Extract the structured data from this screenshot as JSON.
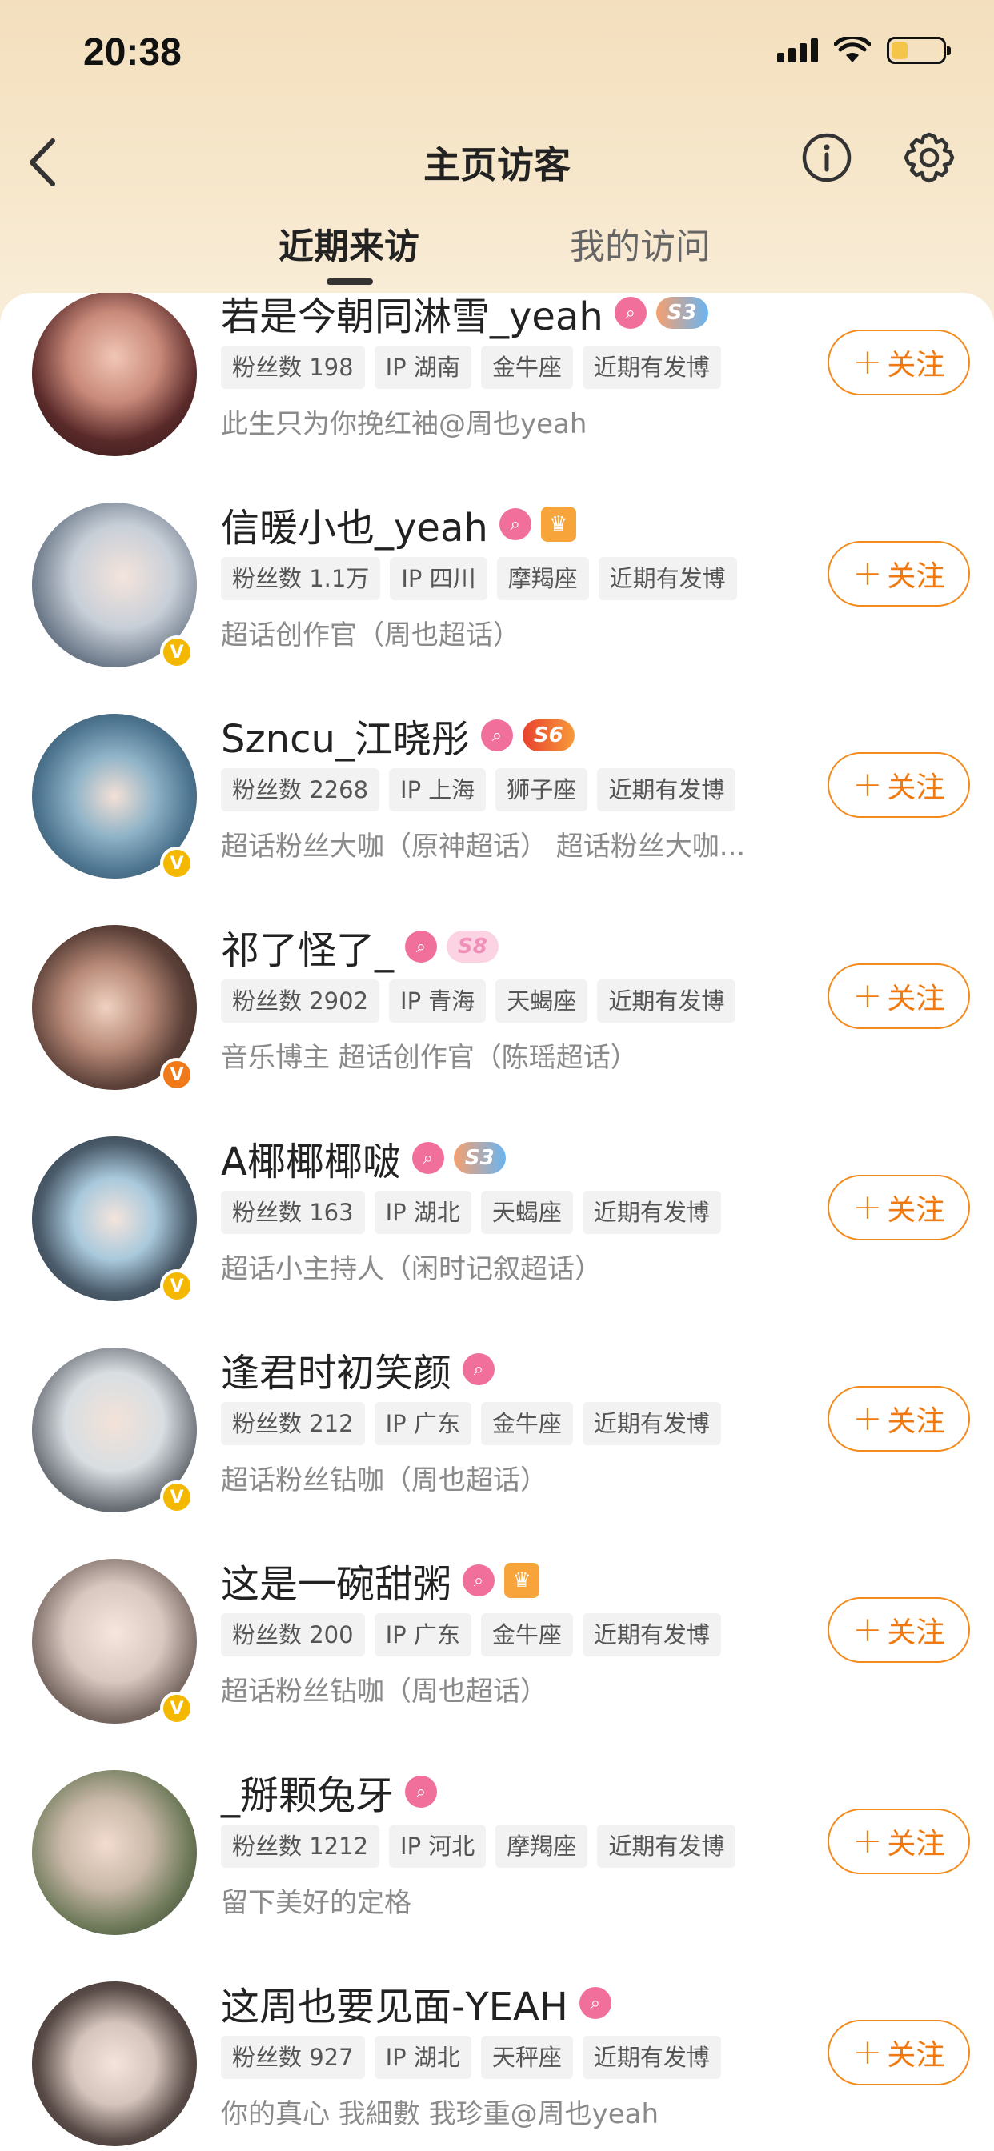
{
  "status": {
    "time": "20:38"
  },
  "header": {
    "title": "主页访客"
  },
  "tabs": [
    {
      "label": "近期来访"
    },
    {
      "label": "我的访问"
    }
  ],
  "follow_label": "关注",
  "visitors": [
    {
      "name": "若是今朝同淋雪_yeah",
      "level": "S3",
      "tags": [
        "粉丝数 198",
        "IP 湖南",
        "金牛座",
        "近期有发博"
      ],
      "bio": "此生只为你挽红袖@周也yeah"
    },
    {
      "name": "信暖小也_yeah",
      "level": "",
      "tags": [
        "粉丝数 1.1万",
        "IP 四川",
        "摩羯座",
        "近期有发博"
      ],
      "bio": "超话创作官（周也超话）"
    },
    {
      "name": "Szncu_江晓彤",
      "level": "S6",
      "tags": [
        "粉丝数 2268",
        "IP 上海",
        "狮子座",
        "近期有发博"
      ],
      "bio": "超话粉丝大咖（原神超话） 超话粉丝大咖..."
    },
    {
      "name": "祁了怪了_",
      "level": "S8",
      "tags": [
        "粉丝数 2902",
        "IP 青海",
        "天蝎座",
        "近期有发博"
      ],
      "bio": "音乐博主 超话创作官（陈瑶超话）"
    },
    {
      "name": "A椰椰椰啵",
      "level": "S3",
      "tags": [
        "粉丝数 163",
        "IP 湖北",
        "天蝎座",
        "近期有发博"
      ],
      "bio": "超话小主持人（闲时记叙超话）"
    },
    {
      "name": "逢君时初笑颜",
      "level": "",
      "tags": [
        "粉丝数 212",
        "IP 广东",
        "金牛座",
        "近期有发博"
      ],
      "bio": "超话粉丝钻咖（周也超话）"
    },
    {
      "name": "这是一碗甜粥",
      "level": "",
      "tags": [
        "粉丝数 200",
        "IP 广东",
        "金牛座",
        "近期有发博"
      ],
      "bio": "超话粉丝钻咖（周也超话）"
    },
    {
      "name": "_掰颗兔牙",
      "level": "",
      "tags": [
        "粉丝数 1212",
        "IP 河北",
        "摩羯座",
        "近期有发博"
      ],
      "bio": "留下美好的定格"
    },
    {
      "name": "这周也要见面-YEAH",
      "level": "",
      "tags": [
        "粉丝数 927",
        "IP 湖北",
        "天秤座",
        "近期有发博"
      ],
      "bio": "你的真心 我細數 我珍重@周也yeah"
    }
  ],
  "colors": {
    "accent": "#f07a0f",
    "header_bg": "#f3dfbd"
  },
  "icons": [
    "back-icon",
    "info-icon",
    "gear-icon",
    "search-badge-icon",
    "verified-icon"
  ]
}
